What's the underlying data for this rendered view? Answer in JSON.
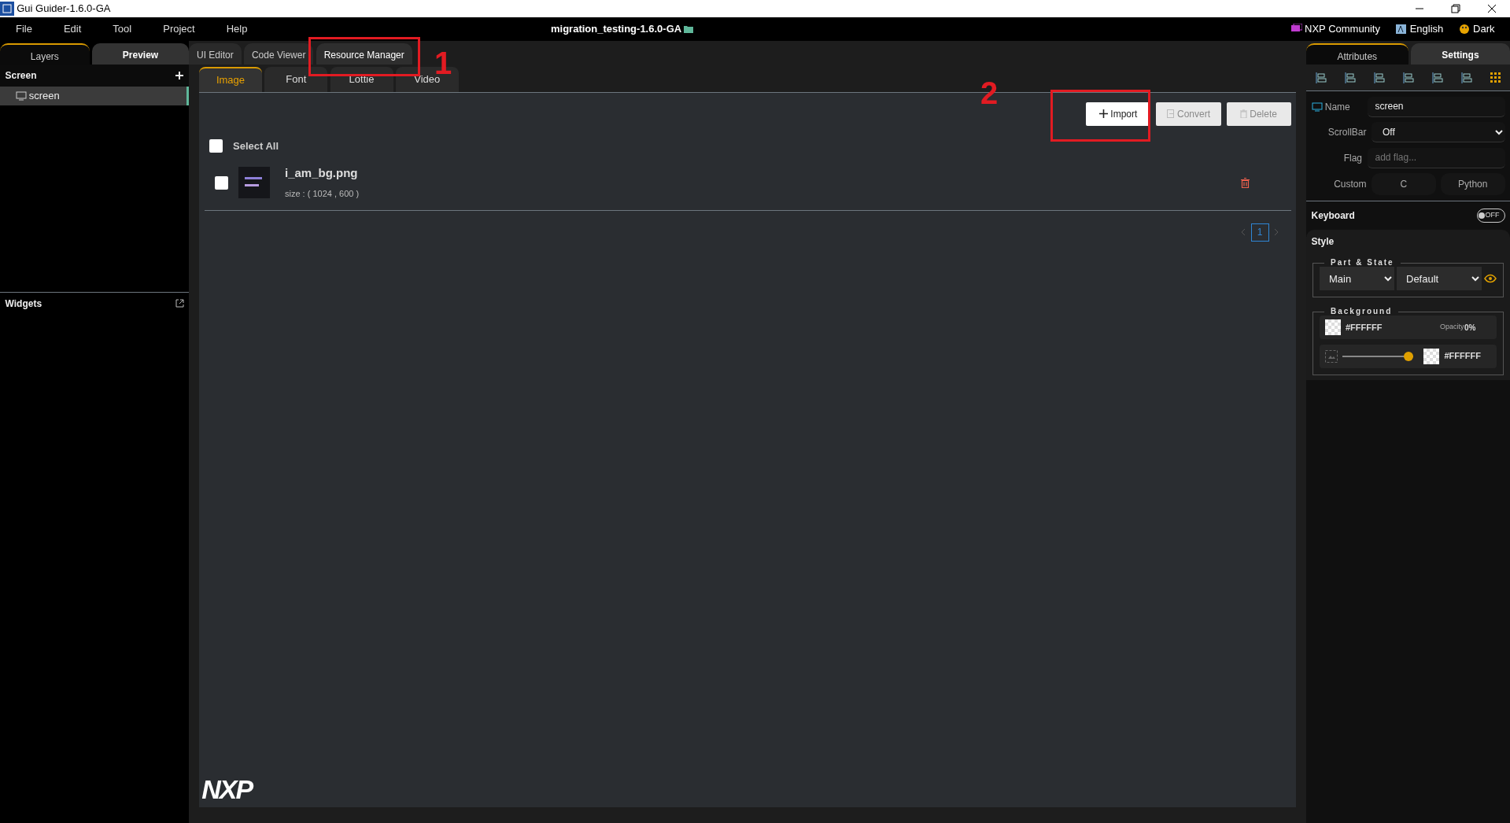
{
  "window": {
    "title": "Gui Guider-1.6.0-GA",
    "project": "migration_testing-1.6.0-GA"
  },
  "menu": [
    "File",
    "Edit",
    "Tool",
    "Project",
    "Help"
  ],
  "top_right": [
    {
      "kind": "chat",
      "label": "NXP Community"
    },
    {
      "kind": "lang",
      "label": "English"
    },
    {
      "kind": "palette",
      "label": "Dark"
    }
  ],
  "left_tabs": [
    {
      "label": "Layers",
      "selected": true
    },
    {
      "label": "Preview",
      "selected": false
    }
  ],
  "screen_panel": {
    "title": "Screen",
    "items": [
      {
        "label": "screen",
        "selected": true
      }
    ]
  },
  "widgets_panel": {
    "title": "Widgets"
  },
  "main_tabs": [
    {
      "label": "UI Editor",
      "selected": false
    },
    {
      "label": "Code Viewer",
      "selected": false
    },
    {
      "label": "Resource Manager",
      "selected": true
    }
  ],
  "resource_tabs": [
    {
      "label": "Image",
      "selected": true
    },
    {
      "label": "Font",
      "selected": false
    },
    {
      "label": "Lottie",
      "selected": false
    },
    {
      "label": "Video",
      "selected": false
    }
  ],
  "actions": [
    {
      "kind": "import",
      "label": "Import",
      "disabled": false
    },
    {
      "kind": "convert",
      "label": "Convert",
      "disabled": true
    },
    {
      "kind": "delete",
      "label": "Delete",
      "disabled": true
    }
  ],
  "select_all": {
    "label": "Select All",
    "checked": false
  },
  "images": [
    {
      "name": "i_am_bg.png",
      "size": "size : ( 1024 , 600 )",
      "checked": false
    }
  ],
  "pagination": [
    {
      "label": "1",
      "selected": true
    }
  ],
  "logo": "NXP",
  "annotations": [
    {
      "label": "1"
    },
    {
      "label": "2"
    }
  ],
  "right_tabs": [
    {
      "label": "Attributes",
      "selected": true
    },
    {
      "label": "Settings",
      "selected": false
    }
  ],
  "attributes": {
    "name_label": "Name",
    "name_value": "screen",
    "scrollbar_label": "ScrollBar",
    "scrollbar_value": "Off",
    "flag_label": "Flag",
    "flag_placeholder": "add flag...",
    "custom_label": "Custom",
    "custom_buttons": [
      "C",
      "Python"
    ]
  },
  "keyboard": {
    "label": "Keyboard",
    "on": false,
    "toggle_text": "OFF"
  },
  "style": {
    "title": "Style",
    "part_state_legend": "Part & State",
    "part": "Main",
    "state": "Default",
    "background_legend": "Background",
    "color_text": "#FFFFFF",
    "opacity_label": "Opacity",
    "opacity_value": "0%",
    "gradient": {
      "level": 1,
      "color_text": "#FFFFFF"
    }
  }
}
